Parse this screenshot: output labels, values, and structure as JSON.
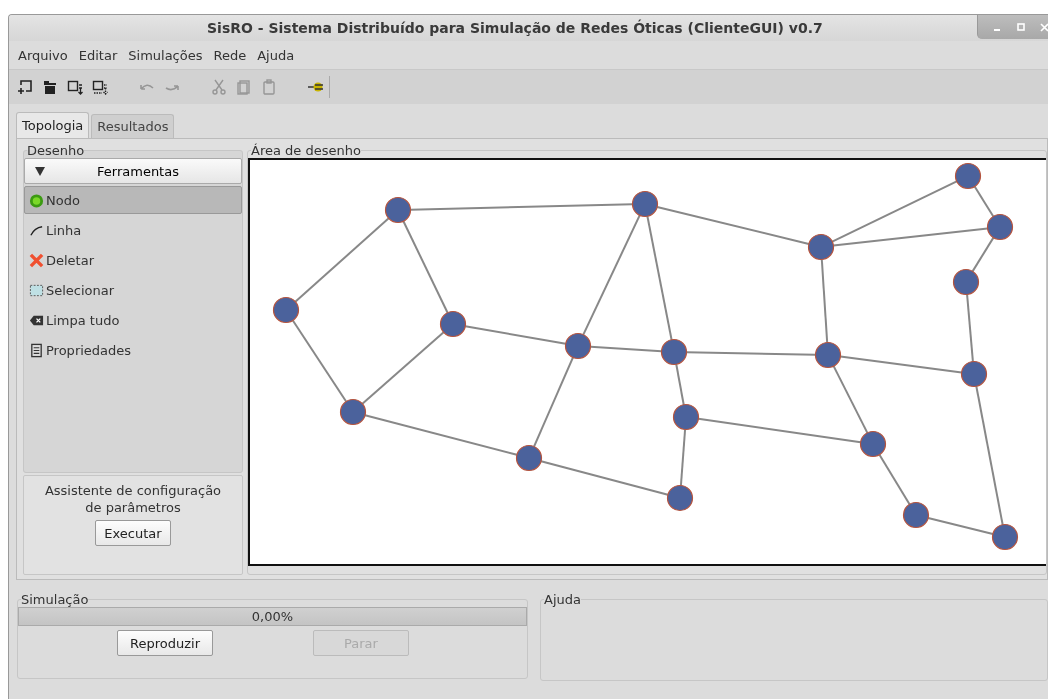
{
  "window": {
    "title": "SisRO - Sistema Distribuído para Simulação de Redes Óticas (ClienteGUI) v0.7"
  },
  "menu": [
    "Arquivo",
    "Editar",
    "Simulações",
    "Rede",
    "Ajuda"
  ],
  "toolbar": [
    {
      "kind": "new",
      "disabled": false
    },
    {
      "kind": "open",
      "disabled": false
    },
    {
      "kind": "save",
      "disabled": false
    },
    {
      "kind": "save_as",
      "disabled": false
    },
    {
      "kind": "undo",
      "disabled": true
    },
    {
      "kind": "redo",
      "disabled": true
    },
    {
      "kind": "cut",
      "disabled": true
    },
    {
      "kind": "copy",
      "disabled": true
    },
    {
      "kind": "paste",
      "disabled": true
    },
    {
      "kind": "connect",
      "disabled": false
    }
  ],
  "tabs": [
    {
      "label": "Topologia",
      "selected": true
    },
    {
      "label": "Resultados",
      "selected": false
    }
  ],
  "drawing": {
    "title": "Desenho",
    "tools_header": "Ferramentas",
    "tools": [
      {
        "kind": "node",
        "label": "Nodo",
        "selected": true
      },
      {
        "kind": "line",
        "label": "Linha",
        "selected": false
      },
      {
        "kind": "delete",
        "label": "Deletar",
        "selected": false
      },
      {
        "kind": "select",
        "label": "Selecionar",
        "selected": false
      },
      {
        "kind": "clear",
        "label": "Limpa tudo",
        "selected": false
      },
      {
        "kind": "properties",
        "label": "Propriedades",
        "selected": false
      }
    ],
    "wizard_text": "Assistente de configuração de parâmetros",
    "wizard_button": "Executar"
  },
  "canvas": {
    "title": "Área de desenho"
  },
  "simulation": {
    "title": "Simulação",
    "reading": "0,00%",
    "buttons": [
      {
        "label": "Reproduzir",
        "disabled": false
      },
      {
        "label": "Parar",
        "disabled": true
      }
    ]
  },
  "help": {
    "title": "Ajuda"
  }
}
